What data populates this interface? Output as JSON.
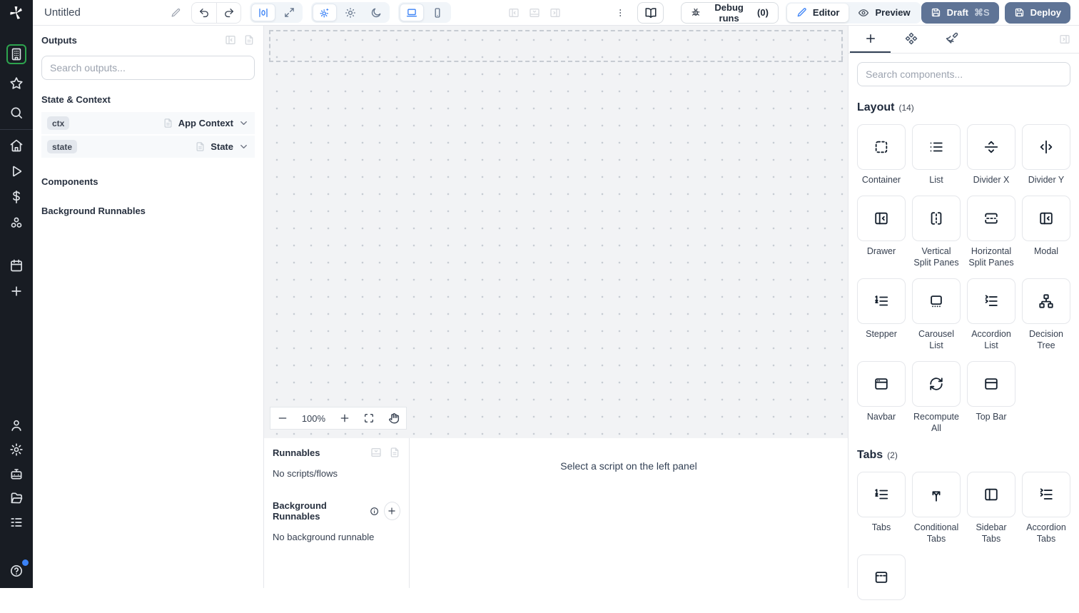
{
  "topbar": {
    "app_title": "Untitled",
    "debug_runs": {
      "label": "Debug runs",
      "count": "(0)"
    },
    "mode_switch": {
      "editor": "Editor",
      "preview": "Preview"
    },
    "draft": {
      "label": "Draft",
      "shortcut": "⌘S"
    },
    "deploy": {
      "label": "Deploy"
    }
  },
  "sidebar": {
    "top": [
      {
        "name": "apps",
        "icon": "building-icon",
        "selected": true
      },
      {
        "name": "favorites",
        "icon": "star-icon",
        "selected": false
      },
      {
        "name": "search",
        "icon": "search-icon",
        "selected": false
      }
    ],
    "middle": [
      {
        "name": "home",
        "icon": "home-icon"
      },
      {
        "name": "runs",
        "icon": "play-icon"
      },
      {
        "name": "variables",
        "icon": "dollar-icon"
      },
      {
        "name": "resources",
        "icon": "resources-icon"
      },
      {
        "name": "schedules",
        "icon": "calendar-icon",
        "gap_before": true
      },
      {
        "name": "create",
        "icon": "plus-icon"
      }
    ],
    "bottom": [
      {
        "name": "account",
        "icon": "user-icon"
      },
      {
        "name": "settings",
        "icon": "gear-icon"
      },
      {
        "name": "workers",
        "icon": "robot-icon"
      },
      {
        "name": "folders",
        "icon": "folder-open-icon"
      },
      {
        "name": "logs",
        "icon": "list-details-icon"
      }
    ],
    "help": {
      "name": "help",
      "icon": "help-icon",
      "notification": true
    }
  },
  "outputs_panel": {
    "title": "Outputs",
    "search_placeholder": "Search outputs...",
    "section_state_context": "State & Context",
    "section_components": "Components",
    "section_background_runnables": "Background Runnables",
    "rows": [
      {
        "badge": "ctx",
        "type": "App Context",
        "doc_icon": "file-icon",
        "chevron_icon": "chevron-down-icon"
      },
      {
        "badge": "state",
        "type": "State",
        "doc_icon": "file-icon",
        "chevron_icon": "chevron-down-icon"
      }
    ]
  },
  "canvas": {
    "zoom_level": "100%"
  },
  "runnables_panel": {
    "title": "Runnables",
    "empty": "No scripts/flows",
    "background_title": "Background Runnables",
    "background_empty": "No background runnable",
    "select_hint": "Select a script on the left panel"
  },
  "components_panel": {
    "search_placeholder": "Search components...",
    "sections": [
      {
        "title": "Layout",
        "count": "(14)",
        "items": [
          {
            "label": "Container",
            "icon": "container-icon"
          },
          {
            "label": "List",
            "icon": "list-icon"
          },
          {
            "label": "Divider X",
            "icon": "divider-x-icon"
          },
          {
            "label": "Divider Y",
            "icon": "divider-y-icon"
          },
          {
            "label": "Drawer",
            "icon": "drawer-icon"
          },
          {
            "label": "Vertical Split Panes",
            "icon": "vertical-split-icon"
          },
          {
            "label": "Horizontal Split Panes",
            "icon": "horizontal-split-icon"
          },
          {
            "label": "Modal",
            "icon": "modal-icon"
          },
          {
            "label": "Stepper",
            "icon": "stepper-icon"
          },
          {
            "label": "Carousel List",
            "icon": "carousel-icon"
          },
          {
            "label": "Accordion List",
            "icon": "accordion-icon"
          },
          {
            "label": "Decision Tree",
            "icon": "decision-tree-icon"
          },
          {
            "label": "Navbar",
            "icon": "navbar-icon"
          },
          {
            "label": "Recompute All",
            "icon": "recompute-icon"
          },
          {
            "label": "Top Bar",
            "icon": "top-bar-icon"
          }
        ]
      },
      {
        "title": "Tabs",
        "count": "(2)",
        "items": [
          {
            "label": "Tabs",
            "icon": "tabs-icon"
          },
          {
            "label": "Conditional Tabs",
            "icon": "conditional-tabs-icon"
          },
          {
            "label": "Sidebar Tabs",
            "icon": "sidebar-tabs-icon"
          },
          {
            "label": "Accordion Tabs",
            "icon": "accordion-tabs-icon"
          },
          {
            "label": "",
            "icon": "invisible-tabs-icon"
          }
        ]
      }
    ]
  },
  "colors": {
    "accent_blue": "#3b82f6",
    "selection_green": "#2da44e",
    "primary_button": "#5f7496",
    "sidebar_bg": "#181c23"
  }
}
